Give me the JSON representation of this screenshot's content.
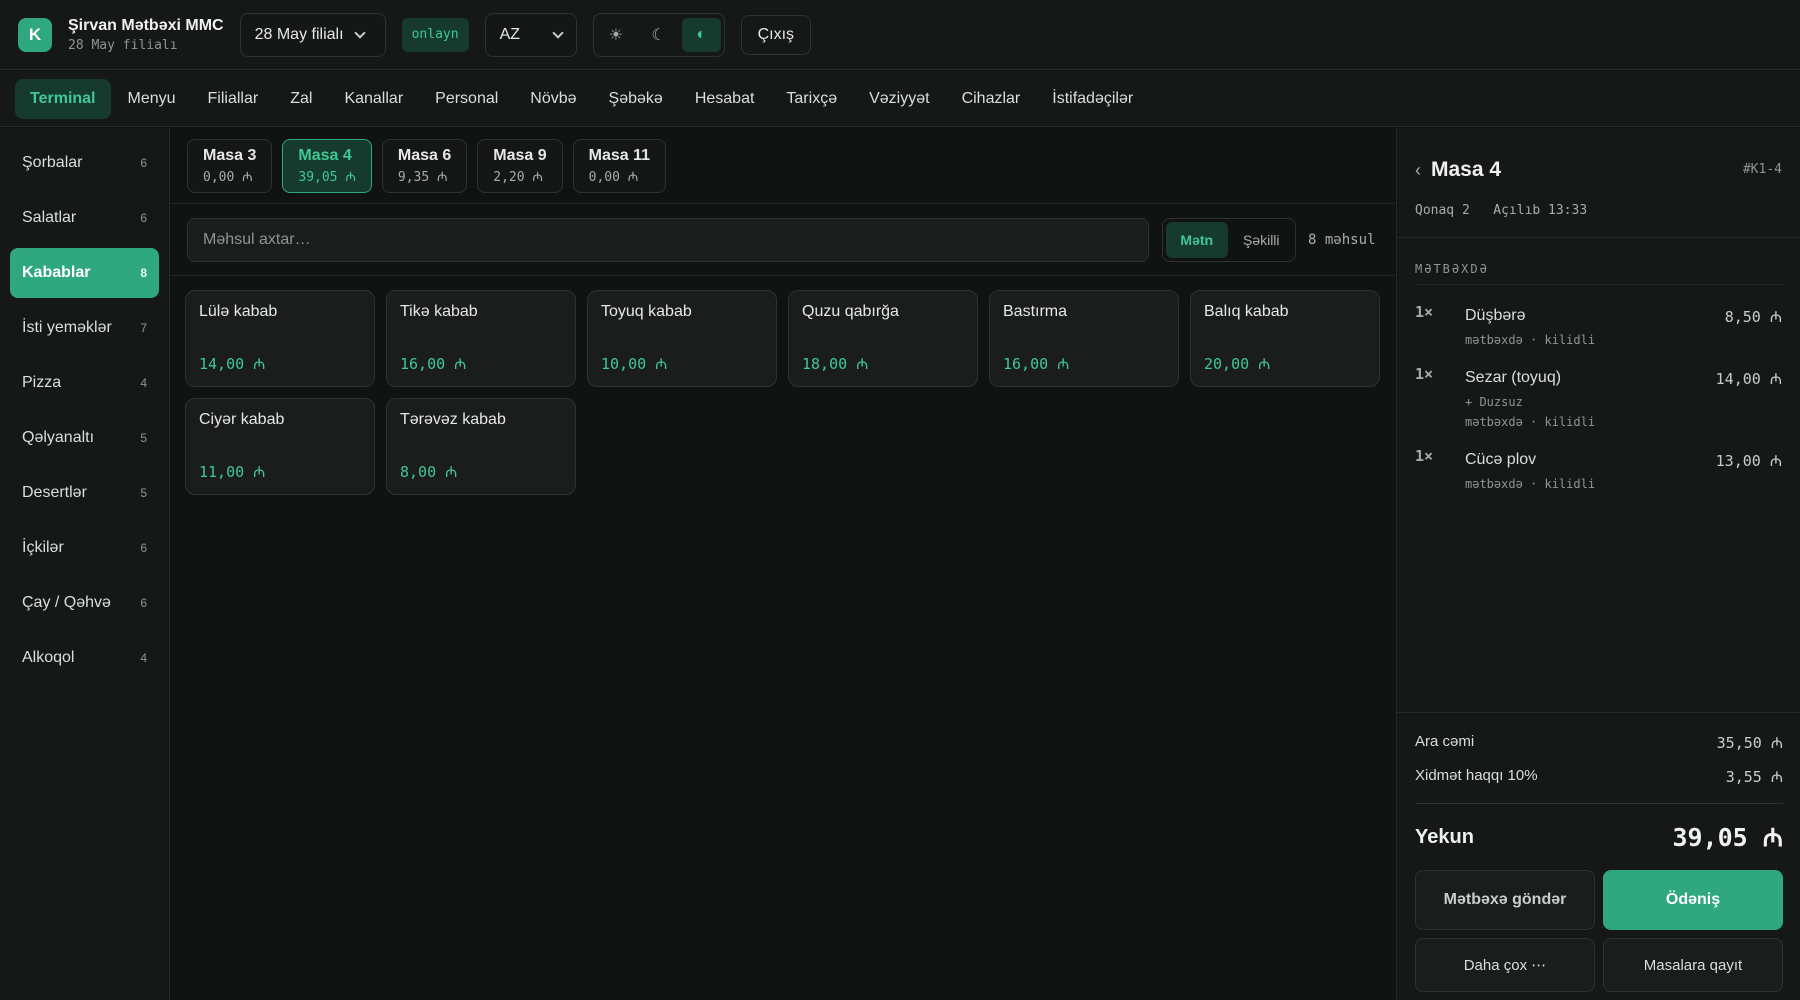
{
  "header": {
    "logo_letter": "K",
    "brand_name": "Şirvan Mətbəxi MMC",
    "brand_sub": "28 May filialı",
    "branch_select": "28 May filialı",
    "status_badge": "onlayn",
    "language": "AZ",
    "theme_icons": {
      "light": "☀",
      "dark": "☾",
      "auto": "◐"
    },
    "logout_label": "Çıxış"
  },
  "nav": {
    "items": [
      "Terminal",
      "Menyu",
      "Filiallar",
      "Zal",
      "Kanallar",
      "Personal",
      "Növbə",
      "Şəbəkə",
      "Hesabat",
      "Tarixçə",
      "Vəziyyət",
      "Cihazlar",
      "İstifadəçilər"
    ],
    "active": "Terminal"
  },
  "sidebar": {
    "categories": [
      {
        "label": "Şorbalar",
        "count": "6"
      },
      {
        "label": "Salatlar",
        "count": "6"
      },
      {
        "label": "Kabablar",
        "count": "8"
      },
      {
        "label": "İsti yeməklər",
        "count": "7"
      },
      {
        "label": "Pizza",
        "count": "4"
      },
      {
        "label": "Qəlyanaltı",
        "count": "5"
      },
      {
        "label": "Desertlər",
        "count": "5"
      },
      {
        "label": "İçkilər",
        "count": "6"
      },
      {
        "label": "Çay / Qəhvə",
        "count": "6"
      },
      {
        "label": "Alkoqol",
        "count": "4"
      }
    ],
    "active": "Kabablar"
  },
  "tables": {
    "items": [
      {
        "name": "Masa 3",
        "amount": "0,00 ₼"
      },
      {
        "name": "Masa 4",
        "amount": "39,05 ₼"
      },
      {
        "name": "Masa 6",
        "amount": "9,35 ₼"
      },
      {
        "name": "Masa 9",
        "amount": "2,20 ₼"
      },
      {
        "name": "Masa 11",
        "amount": "0,00 ₼"
      }
    ],
    "active": "Masa 4"
  },
  "search": {
    "placeholder": "Məhsul axtar…",
    "value": "",
    "view_text": "Mətn",
    "view_image": "Şəkilli",
    "view_active": "Mətn",
    "product_count": "8 məhsul"
  },
  "products": [
    {
      "name": "Lülə kabab",
      "price": "14,00 ₼"
    },
    {
      "name": "Tikə kabab",
      "price": "16,00 ₼"
    },
    {
      "name": "Toyuq kabab",
      "price": "10,00 ₼"
    },
    {
      "name": "Quzu qabırğa",
      "price": "18,00 ₼"
    },
    {
      "name": "Bastırma",
      "price": "16,00 ₼"
    },
    {
      "name": "Balıq kabab",
      "price": "20,00 ₼"
    },
    {
      "name": "Ciyər kabab",
      "price": "11,00 ₼"
    },
    {
      "name": "Tərəvəz kabab",
      "price": "8,00 ₼"
    }
  ],
  "order": {
    "back_icon": "‹",
    "title": "Masa 4",
    "order_id": "#K1-4",
    "meta": "Qonaq 2   Açılıb 13:33",
    "section_label": "MƏTBƏXDƏ",
    "lines": [
      {
        "qty": "1×",
        "name": "Düşbərə",
        "modifier": "",
        "status": "mətbəxdə · kilidli",
        "price": "8,50 ₼"
      },
      {
        "qty": "1×",
        "name": "Sezar (toyuq)",
        "modifier": "+ Duzsuz",
        "status": "mətbəxdə · kilidli",
        "price": "14,00 ₼"
      },
      {
        "qty": "1×",
        "name": "Cücə plov",
        "modifier": "",
        "status": "mətbəxdə · kilidli",
        "price": "13,00 ₼"
      }
    ],
    "subtotal_label": "Ara cəmi",
    "subtotal": "35,50 ₼",
    "service_label": "Xidmət haqqı 10%",
    "service": "3,55 ₼",
    "total_label": "Yekun",
    "total": "39,05 ₼",
    "send_kitchen_label": "Mətbəxə göndər",
    "pay_label": "Ödəniş",
    "more_label": "Daha çox ⋯",
    "back_tables_label": "Masalara qayıt"
  },
  "colors": {
    "accent": "#2fa77f",
    "accent_text": "#3fc896",
    "background": "#111312",
    "panel": "#161817"
  }
}
